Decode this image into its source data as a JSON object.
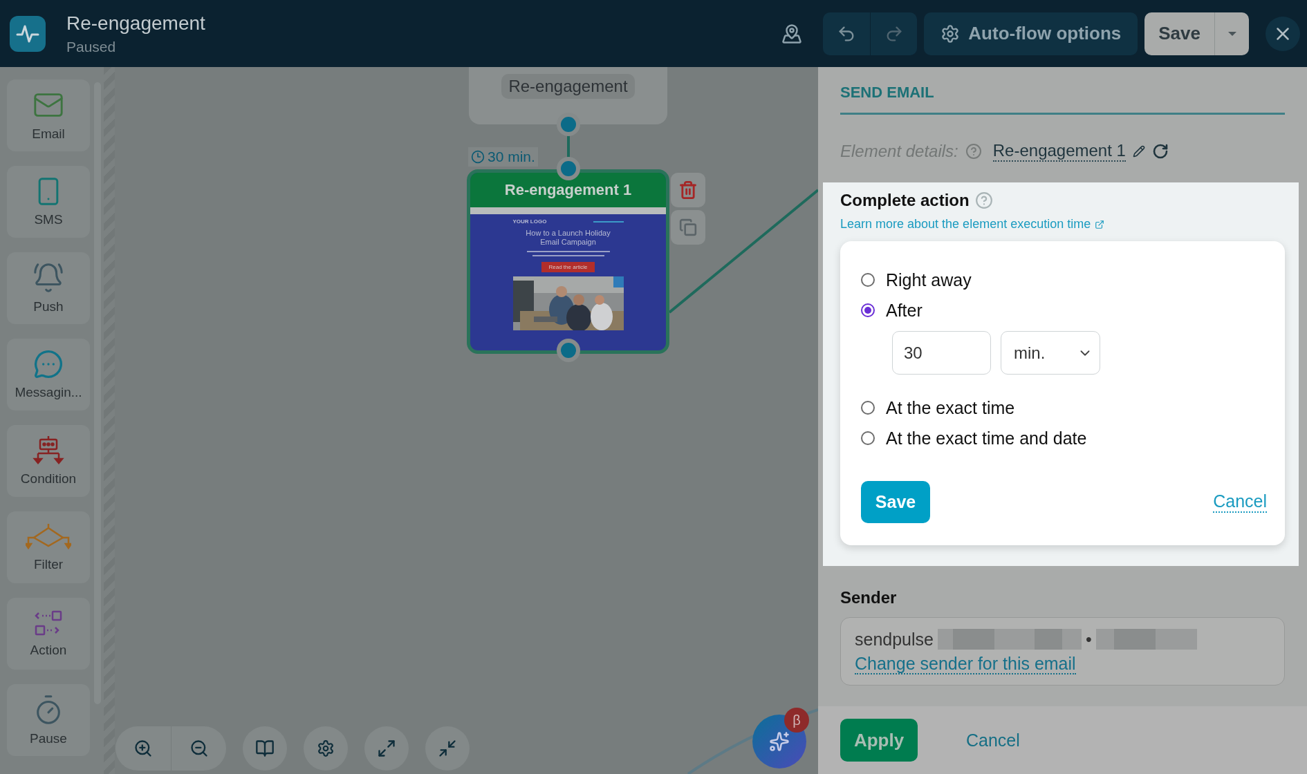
{
  "header": {
    "title": "Re-engagement",
    "status": "Paused",
    "auto_flow_label": "Auto-flow options",
    "save_label": "Save"
  },
  "palette": [
    {
      "label": "Email",
      "kind": "email"
    },
    {
      "label": "SMS",
      "kind": "sms"
    },
    {
      "label": "Push",
      "kind": "push"
    },
    {
      "label": "Messagin...",
      "kind": "messaging"
    },
    {
      "label": "Condition",
      "kind": "condition"
    },
    {
      "label": "Filter",
      "kind": "filter"
    },
    {
      "label": "Action",
      "kind": "action"
    },
    {
      "label": "Pause",
      "kind": "pause"
    }
  ],
  "canvas": {
    "start_node": {
      "label": "Re-engagement"
    },
    "delay_label": "30 min.",
    "email_node": {
      "title": "Re-engagement 1",
      "preview": {
        "logo_text": "YOUR LOGO",
        "headline": "How to a Launch Holiday Email Campaign",
        "button_label": "Read the article"
      }
    },
    "beta_badge": "β"
  },
  "panel": {
    "heading": "SEND EMAIL",
    "details_label": "Element details:",
    "element_name": "Re-engagement 1",
    "complete_action": {
      "title": "Complete action",
      "learn_more": "Learn more about the element execution time",
      "options": [
        {
          "label": "Right away",
          "selected": false
        },
        {
          "label": "After",
          "selected": true,
          "delay": {
            "value": "30",
            "unit": "min."
          }
        },
        {
          "label": "At the exact time",
          "selected": false
        },
        {
          "label": "At the exact time and date",
          "selected": false
        }
      ],
      "save_label": "Save",
      "cancel_label": "Cancel"
    },
    "sender": {
      "title": "Sender",
      "value": "sendpulse",
      "separator": "•",
      "change_link": "Change sender for this email"
    },
    "apply_label": "Apply",
    "cancel_label": "Cancel"
  }
}
